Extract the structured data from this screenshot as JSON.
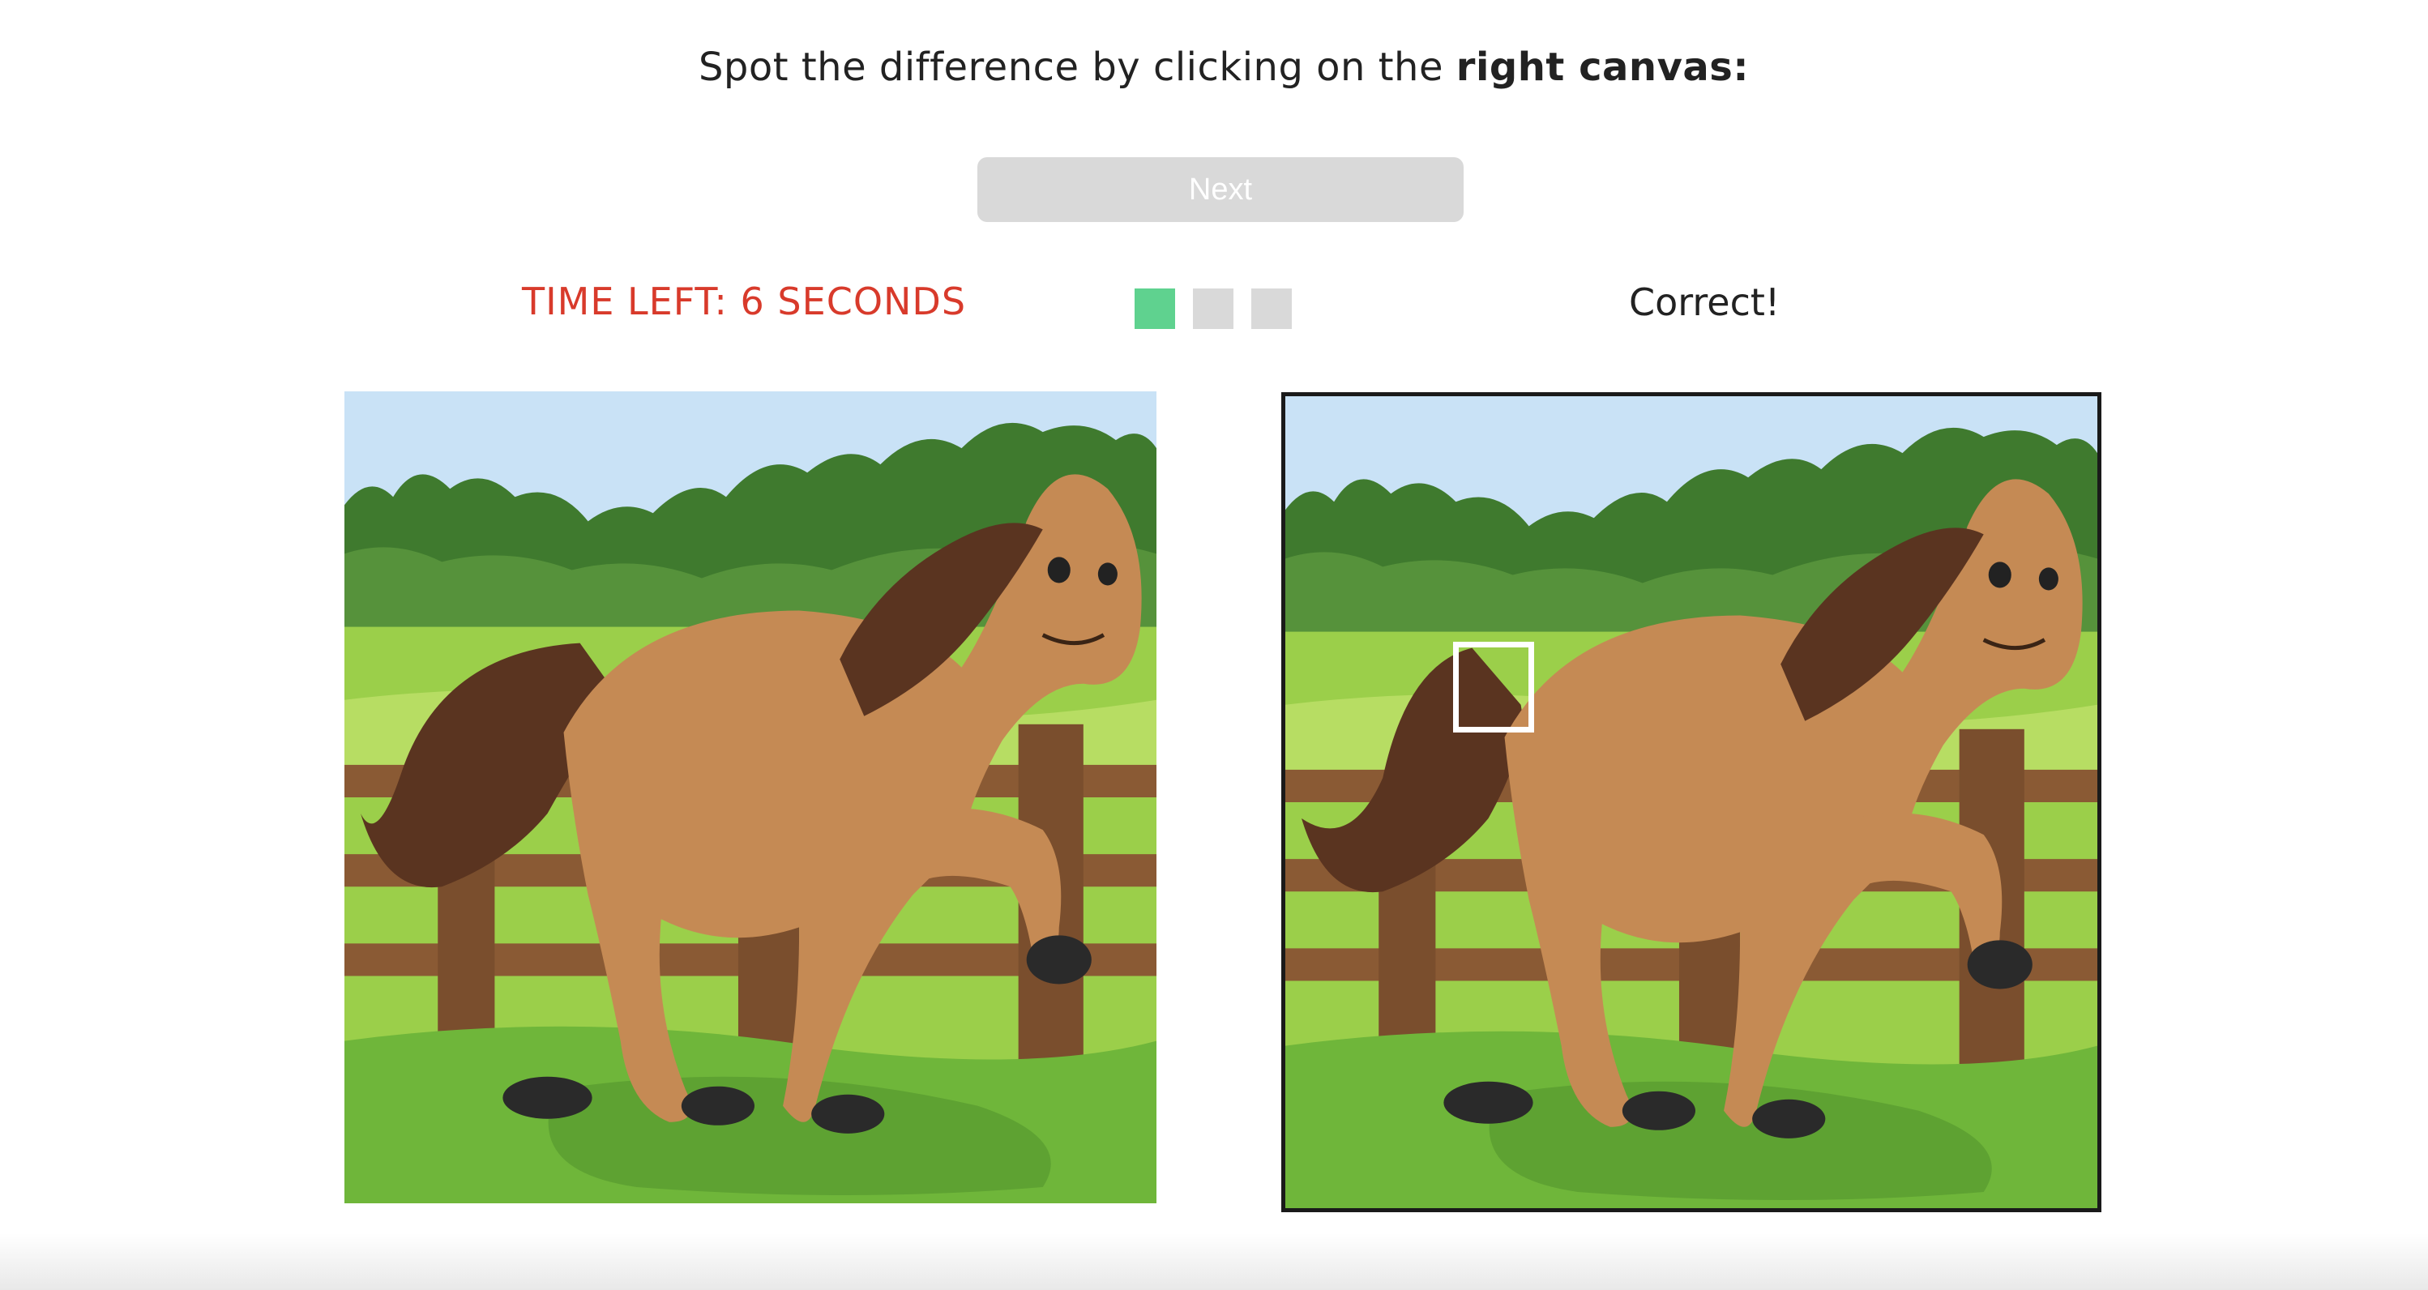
{
  "header": {
    "instruction_text": "Spot the difference by clicking on the ",
    "instruction_emphasis": "right canvas:"
  },
  "next_button": {
    "label": "Next",
    "disabled": true
  },
  "timer": {
    "text": "TIME LEFT: 6 SECONDS",
    "color": "#d83a2b"
  },
  "progress": {
    "found": 1,
    "total": 3,
    "done_color": "#5fd28f",
    "pending_color": "#d9d9d9"
  },
  "status": {
    "text": "Correct!"
  },
  "canvases": {
    "left": {
      "image": "horse-in-paddock",
      "interactable": false
    },
    "right": {
      "image": "horse-in-paddock",
      "interactable": true,
      "selection_marker": "tail-base"
    }
  }
}
